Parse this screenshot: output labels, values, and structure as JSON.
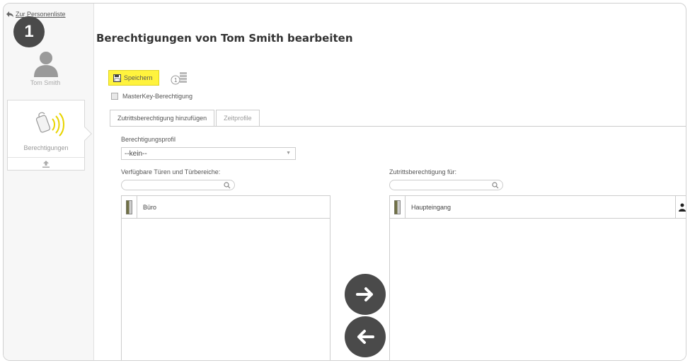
{
  "nav": {
    "back_label": "Zur Personenliste"
  },
  "step": {
    "number": "1"
  },
  "person": {
    "name": "Tom Smith"
  },
  "sidebar": {
    "permissions_label": "Berechtigungen"
  },
  "header": {
    "title": "Berechtigungen von Tom Smith bearbeiten"
  },
  "toolbar": {
    "save_label": "Speichern"
  },
  "masterkey": {
    "label": "MasterKey-Berechtigung",
    "checked": false
  },
  "tabs": [
    {
      "label": "Zutrittsberechtigung hinzufügen",
      "active": true
    },
    {
      "label": "Zeitprofile",
      "active": false
    }
  ],
  "profile": {
    "label": "Berechtigungsprofil",
    "selected": "--kein--"
  },
  "available": {
    "label": "Verfügbare Türen und Türbereiche:",
    "search_placeholder": "",
    "items": [
      "Büro"
    ]
  },
  "assigned": {
    "label": "Zutrittsberechtigung für:",
    "search_placeholder": "",
    "items": [
      "Haupteingang"
    ]
  },
  "colors": {
    "accent_yellow": "#fff33d",
    "dark_button": "#4a4a4a"
  },
  "icons": [
    "back-arrow-icon",
    "user-avatar-icon",
    "access-key-icon",
    "upload-icon",
    "save-icon",
    "stack-hint-icon",
    "search-icon",
    "door-icon",
    "arrow-right-icon",
    "arrow-left-icon",
    "person-icon"
  ]
}
